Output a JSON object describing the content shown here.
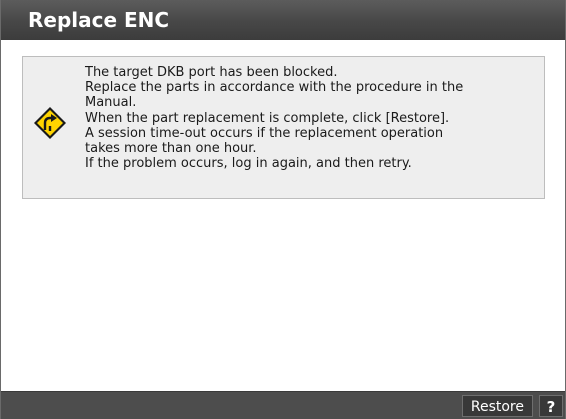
{
  "window": {
    "title": "Replace ENC"
  },
  "message": {
    "icon": "warning-diamond-icon",
    "lines": [
      "The target DKB port has been blocked.",
      "Replace the parts in accordance with the procedure in the",
      "Manual.",
      "When the part replacement is complete, click [Restore].",
      "A session time-out occurs if the replacement operation",
      "takes more than one hour.",
      "If the problem occurs, log in again, and then retry."
    ]
  },
  "footer": {
    "restore_label": "Restore",
    "help_label": "?"
  },
  "colors": {
    "title_bar": "#474747",
    "footer_bar": "#4d4d4d",
    "message_background": "#eeeeee",
    "warning_yellow": "#ffd400"
  }
}
